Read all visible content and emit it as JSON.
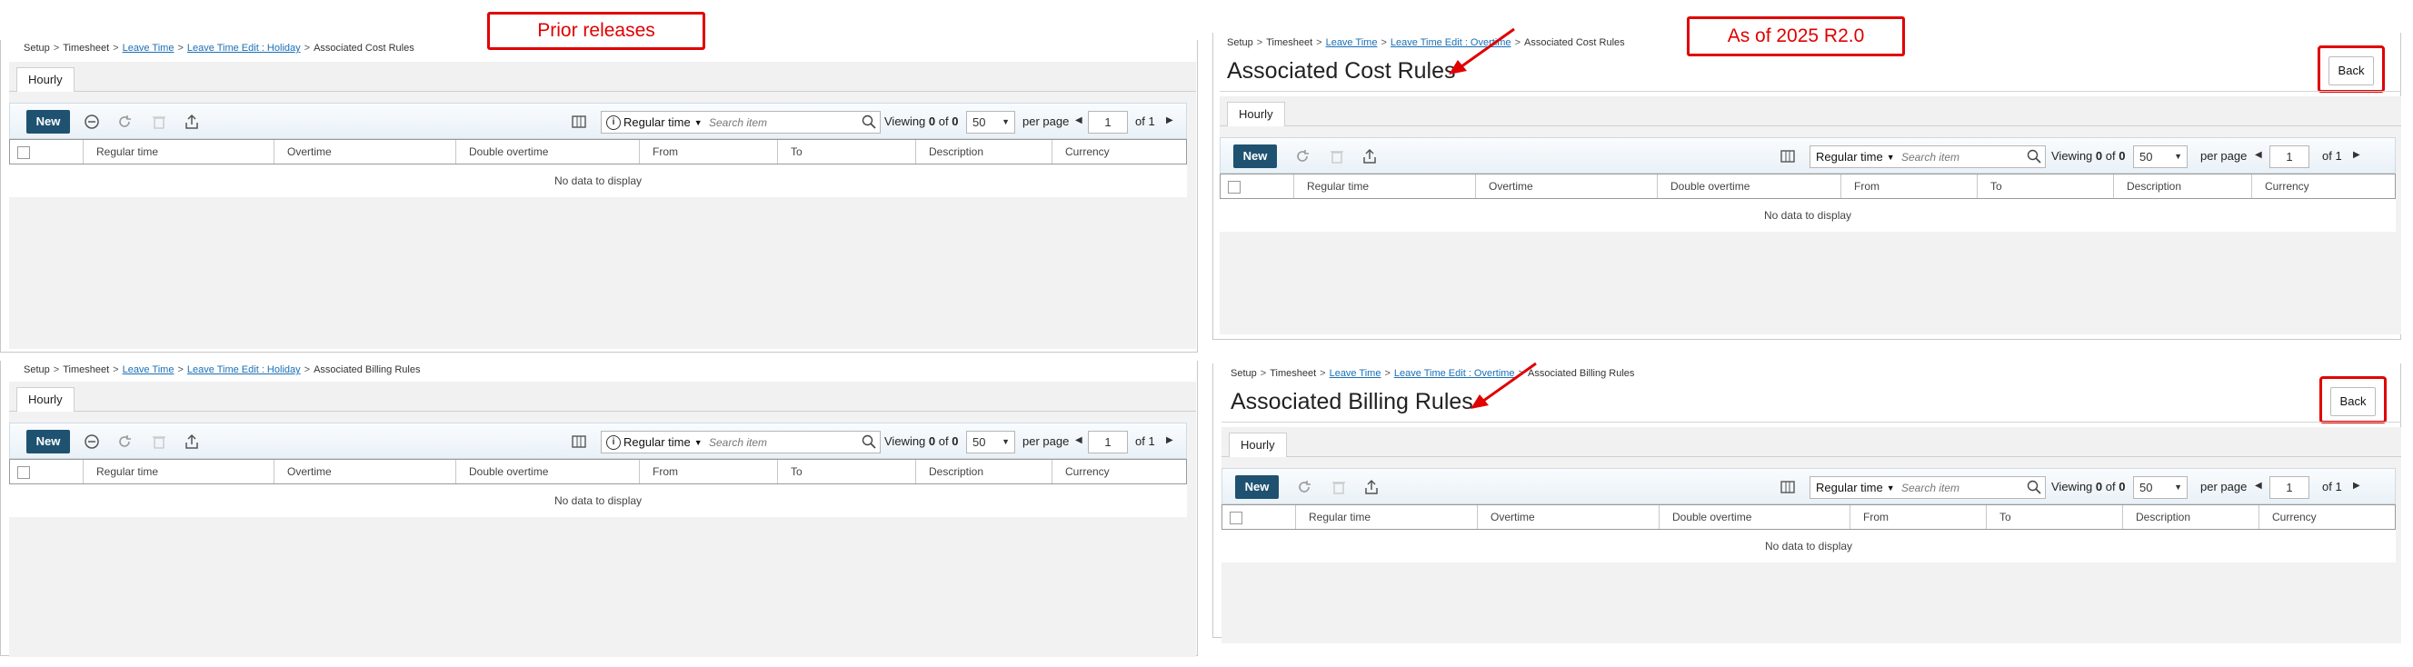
{
  "annotations": {
    "prior": "Prior releases",
    "current": "As of 2025 R2.0",
    "arrow_color": "#e00000"
  },
  "breadcrumb": {
    "setup": "Setup",
    "timesheet": "Timesheet",
    "leave_time": "Leave Time",
    "edit_holiday": "Leave Time Edit : Holiday",
    "edit_overtime": "Leave Time Edit : Overtime",
    "cost_rules": "Associated Cost Rules",
    "billing_rules": "Associated Billing Rules"
  },
  "titles": {
    "cost": "Associated Cost Rules",
    "billing": "Associated Billing Rules"
  },
  "tab_label": "Hourly",
  "back_label": "Back",
  "toolbar": {
    "new_label": "New",
    "filter_value": "Regular time",
    "search_placeholder": "Search item",
    "viewing_prefix": "Viewing",
    "viewing_shown": "0",
    "viewing_of": "of",
    "viewing_total": "0",
    "page_size": "50",
    "per_page": "per page",
    "page_number": "1",
    "page_of": "of 1"
  },
  "columns": [
    "Regular time",
    "Overtime",
    "Double overtime",
    "From",
    "To",
    "Description",
    "Currency"
  ],
  "no_data": "No data to display",
  "colors": {
    "accent": "#1e5270",
    "link": "#1a6fb5",
    "annotation": "#e00000"
  }
}
